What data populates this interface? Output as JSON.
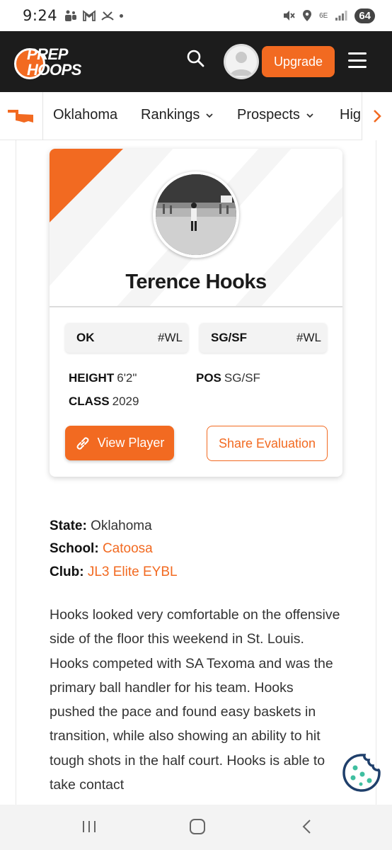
{
  "status_bar": {
    "time": "9:24",
    "battery": "64",
    "network": "6E"
  },
  "header": {
    "logo_line1": "PREP",
    "logo_line2": "HOOPS",
    "upgrade_label": "Upgrade"
  },
  "nav": {
    "items": [
      {
        "label": "Oklahoma"
      },
      {
        "label": "Rankings"
      },
      {
        "label": "Prospects"
      },
      {
        "label": "Hig"
      }
    ]
  },
  "player": {
    "name": "Terence Hooks",
    "tags": [
      {
        "left": "OK",
        "right": "#WL"
      },
      {
        "left": "SG/SF",
        "right": "#WL"
      }
    ],
    "height_label": "HEIGHT",
    "height_value": "6'2\"",
    "pos_label": "POS",
    "pos_value": "SG/SF",
    "class_label": "CLASS",
    "class_value": "2029",
    "view_player_label": "View Player",
    "share_label": "Share Evaluation"
  },
  "info": {
    "state_label": "State:",
    "state_value": "Oklahoma",
    "school_label": "School:",
    "school_value": "Catoosa",
    "club_label": "Club:",
    "club_value": "JL3 Elite EYBL"
  },
  "article": {
    "text": "Hooks looked very comfortable on the offensive side of the floor this weekend in St. Louis. Hooks competed with SA Texoma and was the primary ball handler for his team. Hooks pushed the pace and found easy baskets in transition, while also showing an ability to hit tough shots in the half court. Hooks is able to take contact"
  },
  "colors": {
    "brand": "#f26a21",
    "header_bg": "#1c1c1c"
  },
  "icons": [
    "search-icon",
    "menu-icon",
    "oklahoma-state-icon",
    "chevron-right-icon",
    "link-icon",
    "cookie-icon"
  ]
}
